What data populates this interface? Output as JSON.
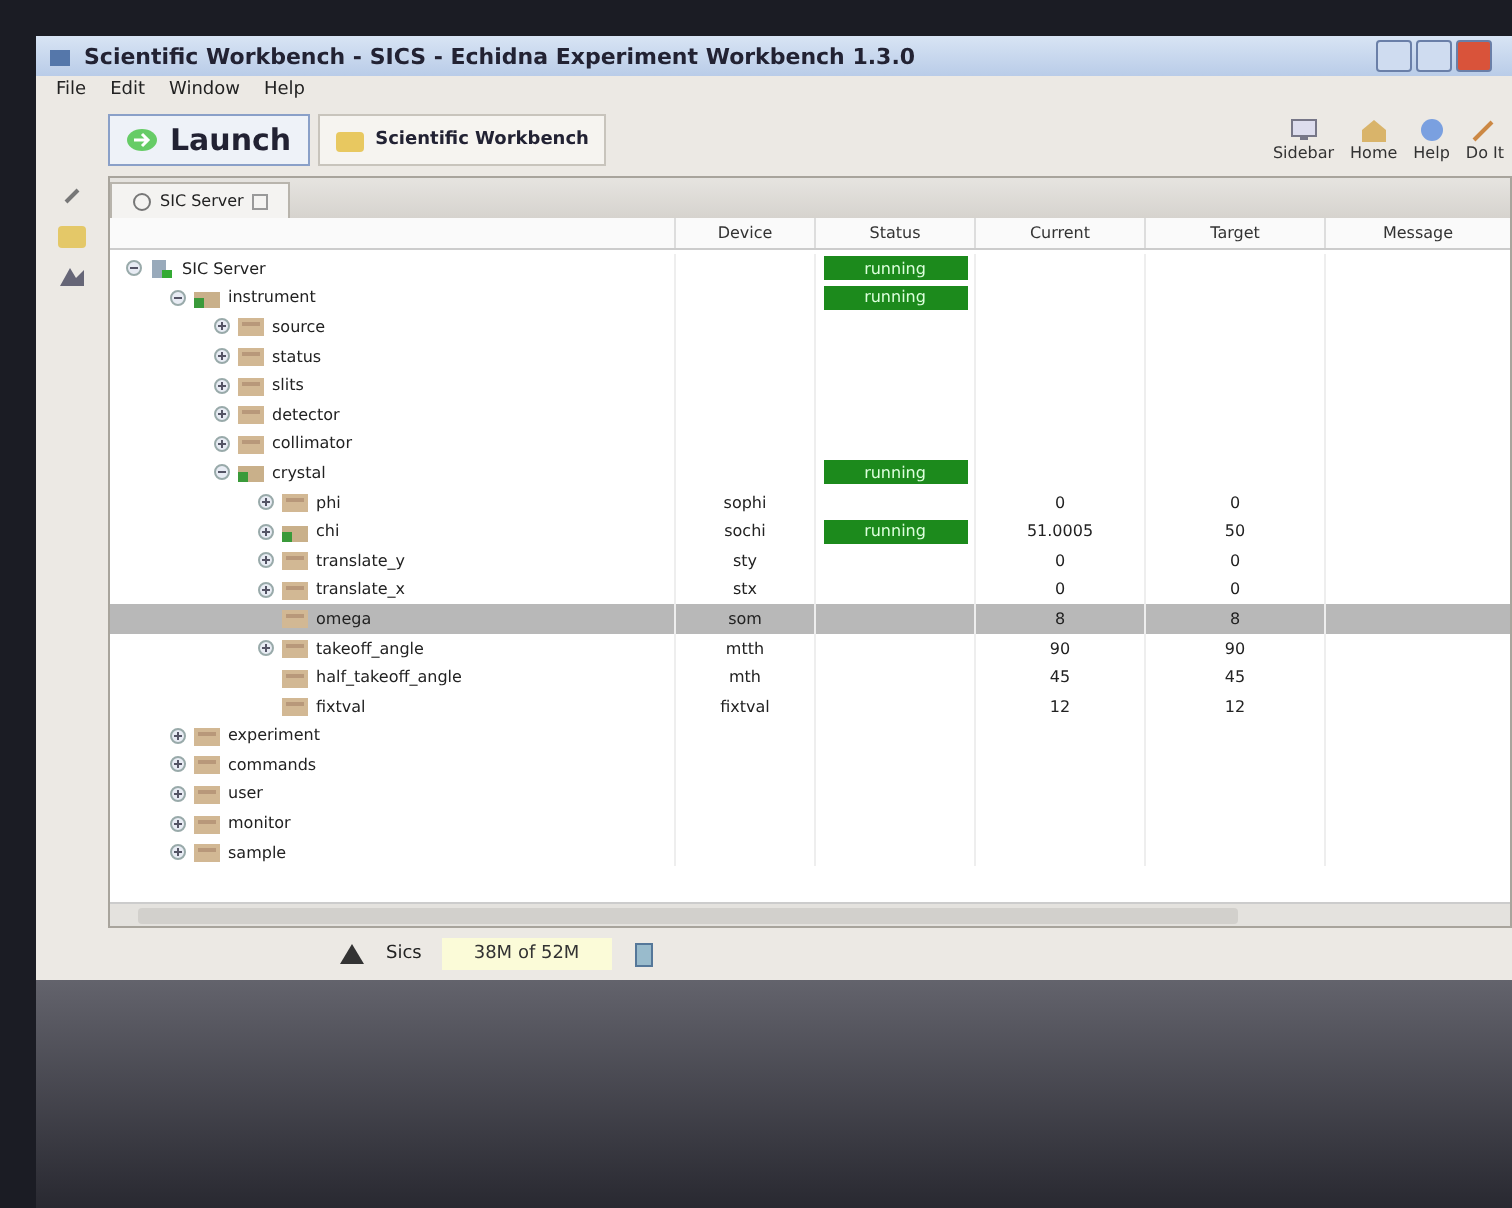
{
  "window": {
    "title": "Scientific Workbench - SICS - Echidna Experiment Workbench 1.3.0"
  },
  "menu": [
    "File",
    "Edit",
    "Window",
    "Help"
  ],
  "perspectives": [
    {
      "label": "Launch",
      "kind": "launch",
      "selected": false
    },
    {
      "label": "Scientific Workbench",
      "kind": "workbench",
      "selected": true
    }
  ],
  "toolbar": [
    {
      "label": "Sidebar",
      "kind": "sidebar"
    },
    {
      "label": "Home",
      "kind": "home"
    },
    {
      "label": "Help",
      "kind": "help"
    },
    {
      "label": "Do It",
      "kind": "doit"
    }
  ],
  "view": {
    "title": "SIC Server"
  },
  "table": {
    "columns": [
      "Device",
      "Status",
      "Current",
      "Target",
      "Message"
    ],
    "rows": [
      {
        "name": "SIC Server",
        "kind": "server",
        "expanded": true,
        "status": "running",
        "children": [
          {
            "name": "instrument",
            "kind": "active",
            "expanded": true,
            "status": "running",
            "children": [
              {
                "name": "source",
                "kind": "folder",
                "expanded": false
              },
              {
                "name": "status",
                "kind": "folder",
                "expanded": false
              },
              {
                "name": "slits",
                "kind": "folder",
                "expanded": false
              },
              {
                "name": "detector",
                "kind": "folder",
                "expanded": false
              },
              {
                "name": "collimator",
                "kind": "folder",
                "expanded": false
              },
              {
                "name": "crystal",
                "kind": "active",
                "expanded": true,
                "status": "running",
                "children": [
                  {
                    "name": "phi",
                    "kind": "folder",
                    "expanded": false,
                    "device": "sophi",
                    "current": "0",
                    "target": "0"
                  },
                  {
                    "name": "chi",
                    "kind": "active",
                    "expanded": false,
                    "device": "sochi",
                    "status": "running",
                    "current": "51.0005",
                    "target": "50"
                  },
                  {
                    "name": "translate_y",
                    "kind": "folder",
                    "expanded": false,
                    "device": "sty",
                    "current": "0",
                    "target": "0"
                  },
                  {
                    "name": "translate_x",
                    "kind": "folder",
                    "expanded": false,
                    "device": "stx",
                    "current": "0",
                    "target": "0"
                  },
                  {
                    "name": "omega",
                    "kind": "folder",
                    "selected": true,
                    "device": "som",
                    "current": "8",
                    "target": "8"
                  },
                  {
                    "name": "takeoff_angle",
                    "kind": "folder",
                    "expanded": false,
                    "device": "mtth",
                    "current": "90",
                    "target": "90"
                  },
                  {
                    "name": "half_takeoff_angle",
                    "kind": "folder",
                    "device": "mth",
                    "current": "45",
                    "target": "45"
                  },
                  {
                    "name": "fixtval",
                    "kind": "folder",
                    "device": "fixtval",
                    "current": "12",
                    "target": "12"
                  }
                ]
              }
            ]
          },
          {
            "name": "experiment",
            "kind": "folder",
            "expanded": false
          },
          {
            "name": "commands",
            "kind": "folder",
            "expanded": false
          },
          {
            "name": "user",
            "kind": "folder",
            "expanded": false
          },
          {
            "name": "monitor",
            "kind": "folder",
            "expanded": false
          },
          {
            "name": "sample",
            "kind": "folder",
            "expanded": false
          }
        ]
      }
    ]
  },
  "status_bar": {
    "connection": "Sics",
    "memory": "38M of 52M"
  }
}
